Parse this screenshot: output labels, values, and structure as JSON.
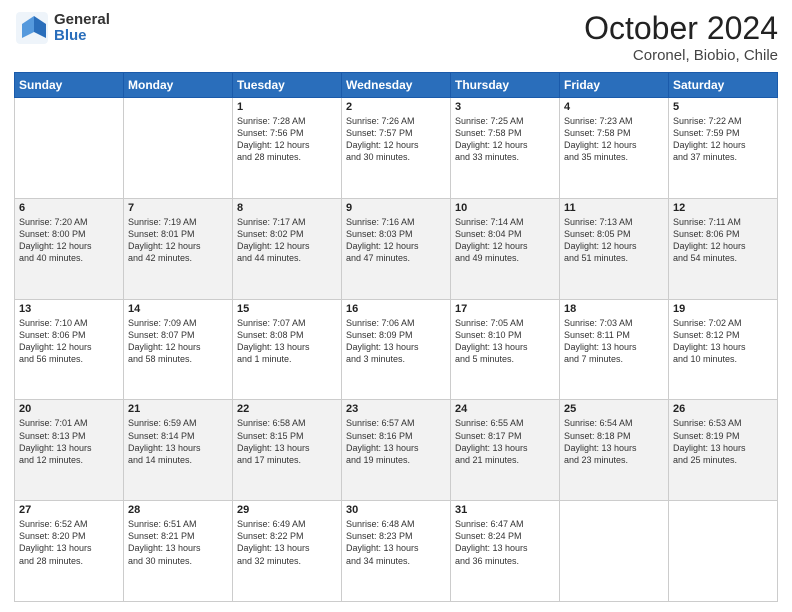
{
  "header": {
    "logo_general": "General",
    "logo_blue": "Blue",
    "month_title": "October 2024",
    "location": "Coronel, Biobio, Chile"
  },
  "days_of_week": [
    "Sunday",
    "Monday",
    "Tuesday",
    "Wednesday",
    "Thursday",
    "Friday",
    "Saturday"
  ],
  "weeks": [
    {
      "shaded": false,
      "days": [
        {
          "num": "",
          "info": ""
        },
        {
          "num": "",
          "info": ""
        },
        {
          "num": "1",
          "info": "Sunrise: 7:28 AM\nSunset: 7:56 PM\nDaylight: 12 hours\nand 28 minutes."
        },
        {
          "num": "2",
          "info": "Sunrise: 7:26 AM\nSunset: 7:57 PM\nDaylight: 12 hours\nand 30 minutes."
        },
        {
          "num": "3",
          "info": "Sunrise: 7:25 AM\nSunset: 7:58 PM\nDaylight: 12 hours\nand 33 minutes."
        },
        {
          "num": "4",
          "info": "Sunrise: 7:23 AM\nSunset: 7:58 PM\nDaylight: 12 hours\nand 35 minutes."
        },
        {
          "num": "5",
          "info": "Sunrise: 7:22 AM\nSunset: 7:59 PM\nDaylight: 12 hours\nand 37 minutes."
        }
      ]
    },
    {
      "shaded": true,
      "days": [
        {
          "num": "6",
          "info": "Sunrise: 7:20 AM\nSunset: 8:00 PM\nDaylight: 12 hours\nand 40 minutes."
        },
        {
          "num": "7",
          "info": "Sunrise: 7:19 AM\nSunset: 8:01 PM\nDaylight: 12 hours\nand 42 minutes."
        },
        {
          "num": "8",
          "info": "Sunrise: 7:17 AM\nSunset: 8:02 PM\nDaylight: 12 hours\nand 44 minutes."
        },
        {
          "num": "9",
          "info": "Sunrise: 7:16 AM\nSunset: 8:03 PM\nDaylight: 12 hours\nand 47 minutes."
        },
        {
          "num": "10",
          "info": "Sunrise: 7:14 AM\nSunset: 8:04 PM\nDaylight: 12 hours\nand 49 minutes."
        },
        {
          "num": "11",
          "info": "Sunrise: 7:13 AM\nSunset: 8:05 PM\nDaylight: 12 hours\nand 51 minutes."
        },
        {
          "num": "12",
          "info": "Sunrise: 7:11 AM\nSunset: 8:06 PM\nDaylight: 12 hours\nand 54 minutes."
        }
      ]
    },
    {
      "shaded": false,
      "days": [
        {
          "num": "13",
          "info": "Sunrise: 7:10 AM\nSunset: 8:06 PM\nDaylight: 12 hours\nand 56 minutes."
        },
        {
          "num": "14",
          "info": "Sunrise: 7:09 AM\nSunset: 8:07 PM\nDaylight: 12 hours\nand 58 minutes."
        },
        {
          "num": "15",
          "info": "Sunrise: 7:07 AM\nSunset: 8:08 PM\nDaylight: 13 hours\nand 1 minute."
        },
        {
          "num": "16",
          "info": "Sunrise: 7:06 AM\nSunset: 8:09 PM\nDaylight: 13 hours\nand 3 minutes."
        },
        {
          "num": "17",
          "info": "Sunrise: 7:05 AM\nSunset: 8:10 PM\nDaylight: 13 hours\nand 5 minutes."
        },
        {
          "num": "18",
          "info": "Sunrise: 7:03 AM\nSunset: 8:11 PM\nDaylight: 13 hours\nand 7 minutes."
        },
        {
          "num": "19",
          "info": "Sunrise: 7:02 AM\nSunset: 8:12 PM\nDaylight: 13 hours\nand 10 minutes."
        }
      ]
    },
    {
      "shaded": true,
      "days": [
        {
          "num": "20",
          "info": "Sunrise: 7:01 AM\nSunset: 8:13 PM\nDaylight: 13 hours\nand 12 minutes."
        },
        {
          "num": "21",
          "info": "Sunrise: 6:59 AM\nSunset: 8:14 PM\nDaylight: 13 hours\nand 14 minutes."
        },
        {
          "num": "22",
          "info": "Sunrise: 6:58 AM\nSunset: 8:15 PM\nDaylight: 13 hours\nand 17 minutes."
        },
        {
          "num": "23",
          "info": "Sunrise: 6:57 AM\nSunset: 8:16 PM\nDaylight: 13 hours\nand 19 minutes."
        },
        {
          "num": "24",
          "info": "Sunrise: 6:55 AM\nSunset: 8:17 PM\nDaylight: 13 hours\nand 21 minutes."
        },
        {
          "num": "25",
          "info": "Sunrise: 6:54 AM\nSunset: 8:18 PM\nDaylight: 13 hours\nand 23 minutes."
        },
        {
          "num": "26",
          "info": "Sunrise: 6:53 AM\nSunset: 8:19 PM\nDaylight: 13 hours\nand 25 minutes."
        }
      ]
    },
    {
      "shaded": false,
      "days": [
        {
          "num": "27",
          "info": "Sunrise: 6:52 AM\nSunset: 8:20 PM\nDaylight: 13 hours\nand 28 minutes."
        },
        {
          "num": "28",
          "info": "Sunrise: 6:51 AM\nSunset: 8:21 PM\nDaylight: 13 hours\nand 30 minutes."
        },
        {
          "num": "29",
          "info": "Sunrise: 6:49 AM\nSunset: 8:22 PM\nDaylight: 13 hours\nand 32 minutes."
        },
        {
          "num": "30",
          "info": "Sunrise: 6:48 AM\nSunset: 8:23 PM\nDaylight: 13 hours\nand 34 minutes."
        },
        {
          "num": "31",
          "info": "Sunrise: 6:47 AM\nSunset: 8:24 PM\nDaylight: 13 hours\nand 36 minutes."
        },
        {
          "num": "",
          "info": ""
        },
        {
          "num": "",
          "info": ""
        }
      ]
    }
  ]
}
